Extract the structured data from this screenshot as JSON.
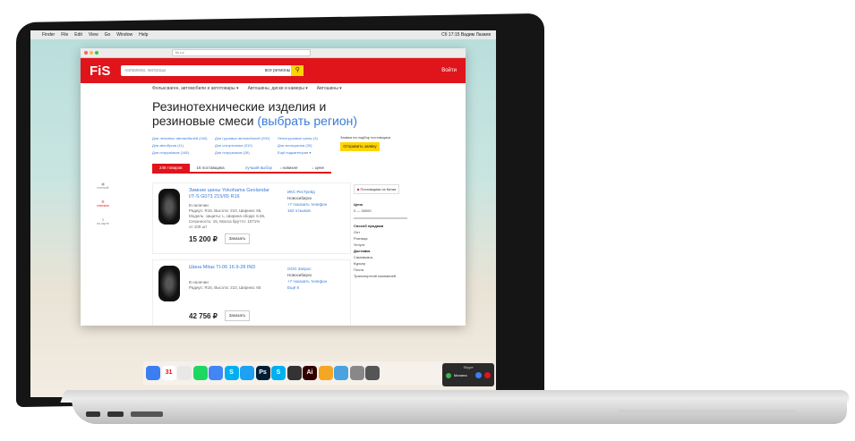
{
  "menubar": {
    "apple": "",
    "items": [
      "Finder",
      "File",
      "Edit",
      "View",
      "Go",
      "Window",
      "Help"
    ],
    "right": "Сб 17:15   Вадим Лазаев"
  },
  "browser": {
    "url": "fis.ru/"
  },
  "header": {
    "logo": "FiS",
    "search_placeholder": "например, матрацы",
    "search_region": "вся регионы",
    "login": "Войти"
  },
  "nav": [
    "Фольксваген, автомобили и автотовары ▾",
    "Автошины, диски и камеры ▾",
    "Автошины ▾"
  ],
  "title": {
    "text": "Резинотехнические изделия и резиновые смеси",
    "region_link": "(выбрать регион)"
  },
  "filters": {
    "col1": [
      "Для легковых автомобилей (163)",
      "Для автобусов (11)",
      "Для погрузчиков (148)"
    ],
    "col2": [
      "Для грузовых автомобилей (200)",
      "Для спецтехники (312)",
      "Для погрузчиков (28)"
    ],
    "col3": [
      "Легкогрузовые шины (3)",
      "Для мотоциклов (33)",
      "Ещё подкатегории ▾"
    ],
    "request_text": "Заявка на подбор поставщика",
    "request_button": "Отправить заявку"
  },
  "tabs": {
    "active": "246 товаров",
    "other": "16 поставщика",
    "sort_label": "лучший выбор",
    "sort2": "↓ новизне",
    "sort3": "↓ цене"
  },
  "leftnav": [
    "плиткой",
    "списком",
    "на карте"
  ],
  "products": [
    {
      "name": "Зимние шины Yokohama Geolandar I/T-S G073 215/65 R16",
      "stock": "В наличии",
      "specs": "Радиус: R16, Высота: 210, Ширина: 65, Модель: защиты: L, Ширина обода: 6.55, Сезонность: 15, Масса брутто: 1071%",
      "min": "от 100 шт",
      "price": "15 200 ₽",
      "order": "Заказать",
      "seller": "ИКС-РесТрейд",
      "city": "Новосибирск",
      "phone": "+7 показать телефон",
      "reviews": "162 отзывов"
    },
    {
      "name": "Шина Mitas TI-06 16.9-28 IND",
      "stock": "В наличии",
      "specs": "Радиус: R16, Высота: 210, Ширина: 65",
      "min": "",
      "price": "42 756 ₽",
      "order": "Заказать",
      "seller": "ООО Запрос",
      "city": "Новосибирск",
      "phone": "+7 показать телефон",
      "reviews": "Ещё 8"
    }
  ],
  "sidebar": {
    "fav": "Поставщики из Китая",
    "price_label": "Цена",
    "from": "0",
    "to": "30000",
    "sale_label": "Способ продажи",
    "sale_opts": [
      "Опт",
      "Розница",
      "Услуги"
    ],
    "delivery_label": "Доставка",
    "delivery_opts": [
      "Самовывоз",
      "Курьер",
      "Почта",
      "Транспортной компанией"
    ]
  },
  "dock": [
    {
      "label": "",
      "color": "#3a7ef2"
    },
    {
      "label": "31",
      "color": "#ffffff"
    },
    {
      "label": "",
      "color": "#e8e8e8"
    },
    {
      "label": "",
      "color": "#1ed760"
    },
    {
      "label": "",
      "color": "#4285f4"
    },
    {
      "label": "S",
      "color": "#00aff0"
    },
    {
      "label": "",
      "color": "#1da1f2"
    },
    {
      "label": "Ps",
      "color": "#001e36"
    },
    {
      "label": "S",
      "color": "#00aff0"
    },
    {
      "label": "",
      "color": "#333333"
    },
    {
      "label": "Ai",
      "color": "#330000"
    },
    {
      "label": "",
      "color": "#f5a623"
    },
    {
      "label": "",
      "color": "#4aa3df"
    },
    {
      "label": "",
      "color": "#888888"
    },
    {
      "label": "",
      "color": "#555555"
    }
  ],
  "notif": {
    "header": "Skype",
    "name": "Малина"
  }
}
